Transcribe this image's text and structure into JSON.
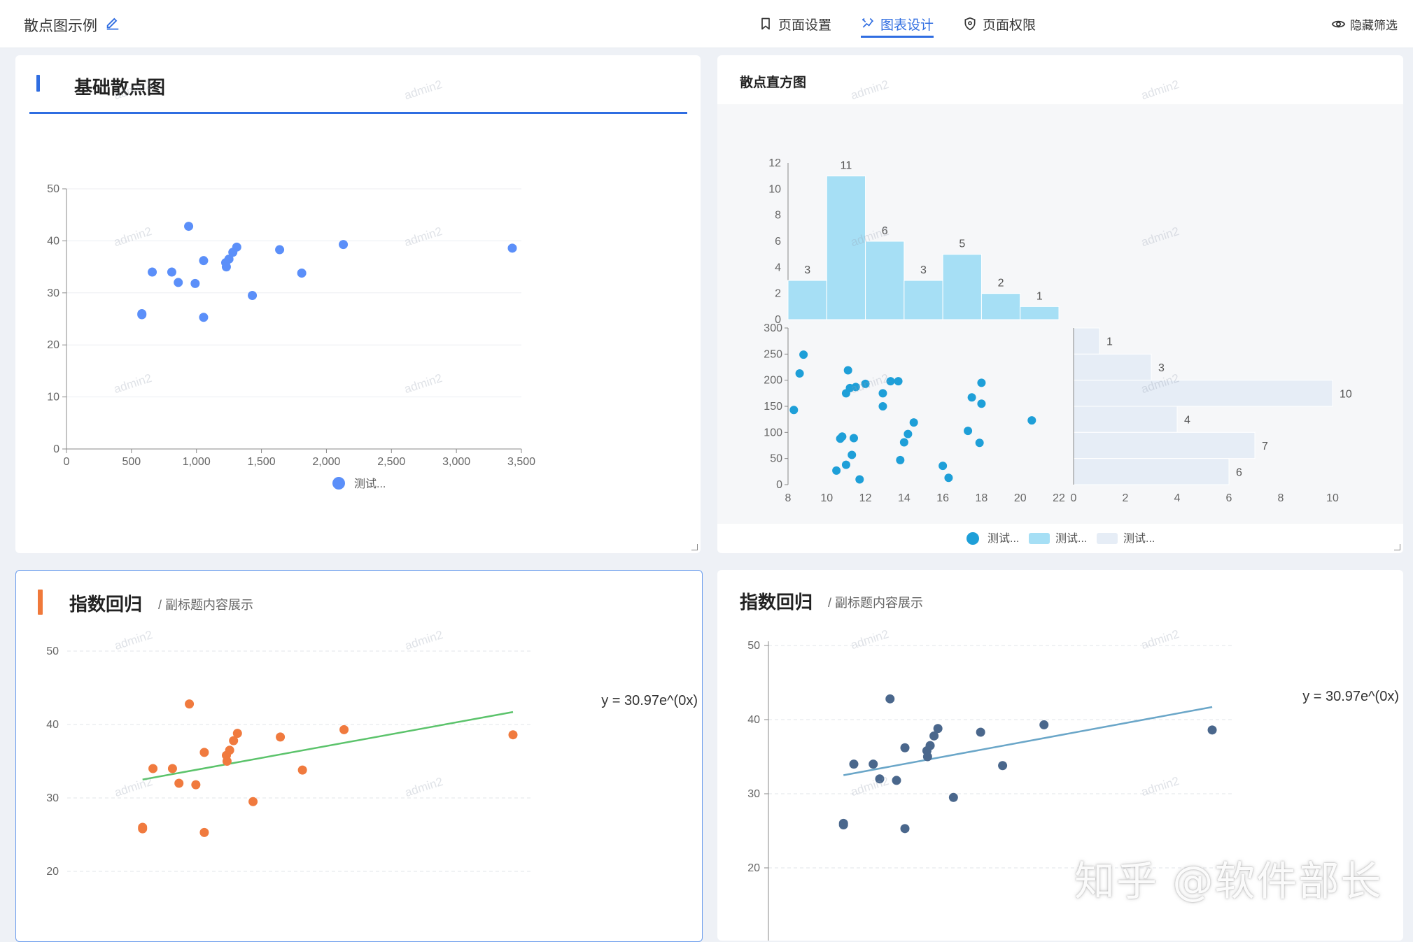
{
  "header": {
    "page_title": "散点图示例",
    "tabs": [
      {
        "label": "页面设置",
        "icon": "bookmark-icon",
        "active": false
      },
      {
        "label": "图表设计",
        "icon": "chart-design-icon",
        "active": true
      },
      {
        "label": "页面权限",
        "icon": "shield-icon",
        "active": false
      }
    ],
    "hide_filter_label": "隐藏筛选"
  },
  "watermark_text": "admin2",
  "corner_watermark": "知乎 @软件部长",
  "panels": {
    "p1": {
      "title": "基础散点图"
    },
    "p2": {
      "title": "散点直方图"
    },
    "p3": {
      "title": "指数回归",
      "subtitle": "/ 副标题内容展示"
    },
    "p4": {
      "title": "指数回归",
      "subtitle": "/ 副标题内容展示"
    }
  },
  "colors": {
    "accent": "#2f6de1",
    "p1_point": "#5b8ff9",
    "p2_point": "#1e9fd8",
    "p2_histx": "#a6dff5",
    "p2_histy": "#e6edf6",
    "p3_point": "#f07a3e",
    "p3_line": "#5bc36b",
    "p4_point": "#4a678c",
    "p4_line": "#6aa6c8"
  },
  "chart_data": [
    {
      "type": "scatter",
      "title": "基础散点图",
      "xlim": [
        0,
        3500
      ],
      "ylim": [
        0,
        50
      ],
      "x_ticks": [
        "0",
        "500",
        "1,000",
        "1,500",
        "2,000",
        "2,500",
        "3,000",
        "3,500"
      ],
      "y_ticks": [
        "0",
        "10",
        "20",
        "30",
        "40",
        "50"
      ],
      "legend": [
        "测试..."
      ],
      "points": [
        [
          580,
          26
        ],
        [
          580,
          25.8
        ],
        [
          660,
          34
        ],
        [
          810,
          34
        ],
        [
          860,
          32
        ],
        [
          940,
          42.8
        ],
        [
          990,
          31.8
        ],
        [
          1055,
          36.2
        ],
        [
          1055,
          25.3
        ],
        [
          1225,
          35.8
        ],
        [
          1230,
          35
        ],
        [
          1250,
          36.5
        ],
        [
          1280,
          37.8
        ],
        [
          1310,
          38.8
        ],
        [
          1430,
          29.5
        ],
        [
          1640,
          38.3
        ],
        [
          1810,
          33.8
        ],
        [
          2130,
          39.3
        ],
        [
          3430,
          38.6
        ]
      ]
    },
    {
      "type": "scatter",
      "title": "散点直方图",
      "xlim": [
        8,
        22
      ],
      "ylim": [
        0,
        300
      ],
      "x_ticks": [
        "8",
        "10",
        "12",
        "14",
        "16",
        "18",
        "20",
        "22"
      ],
      "y_ticks": [
        "0",
        "50",
        "100",
        "150",
        "200",
        "250",
        "300"
      ],
      "legend": [
        "测试...",
        "测试...",
        "测试..."
      ],
      "points": [
        [
          8.3,
          143
        ],
        [
          8.6,
          213
        ],
        [
          8.8,
          249
        ],
        [
          10.5,
          27
        ],
        [
          10.7,
          88
        ],
        [
          10.8,
          92
        ],
        [
          11,
          38
        ],
        [
          11,
          175
        ],
        [
          11.1,
          219
        ],
        [
          11.2,
          185
        ],
        [
          11.3,
          57
        ],
        [
          11.4,
          89
        ],
        [
          11.5,
          187
        ],
        [
          11.7,
          10
        ],
        [
          12,
          193
        ],
        [
          12.9,
          150
        ],
        [
          12.9,
          175
        ],
        [
          13.3,
          198
        ],
        [
          13.7,
          198
        ],
        [
          13.8,
          47
        ],
        [
          14,
          81
        ],
        [
          14.2,
          97
        ],
        [
          14.5,
          119
        ],
        [
          16,
          36
        ],
        [
          16.3,
          13
        ],
        [
          17.3,
          103
        ],
        [
          17.5,
          167
        ],
        [
          17.9,
          80
        ],
        [
          18,
          155
        ],
        [
          18,
          195
        ],
        [
          20.6,
          123
        ]
      ]
    },
    {
      "type": "bar",
      "title": "散点直方图 x-histogram",
      "categories": [
        "8-10",
        "10-12",
        "12-14",
        "14-16",
        "16-18",
        "18-20",
        "20-22"
      ],
      "values": [
        3,
        11,
        6,
        3,
        5,
        2,
        1
      ],
      "ylim": [
        0,
        12
      ],
      "y_ticks": [
        "0",
        "2",
        "4",
        "6",
        "8",
        "10",
        "12"
      ]
    },
    {
      "type": "bar",
      "title": "散点直方图 y-histogram",
      "categories": [
        "250-300",
        "200-250",
        "150-200",
        "100-150",
        "50-100",
        "0-50"
      ],
      "values": [
        1,
        3,
        10,
        4,
        7,
        6
      ],
      "xlim": [
        0,
        10
      ],
      "x_ticks": [
        "0",
        "2",
        "4",
        "6",
        "8",
        "10"
      ]
    },
    {
      "type": "scatter",
      "title": "指数回归",
      "xlim": [
        0,
        3500
      ],
      "ylim": [
        20,
        50
      ],
      "y_ticks": [
        "20",
        "30",
        "40",
        "50"
      ],
      "regression_label": "y = 30.97e^(0x)",
      "regression_line": [
        [
          580,
          32.5
        ],
        [
          3430,
          41.7
        ]
      ],
      "points": [
        [
          580,
          26
        ],
        [
          580,
          25.8
        ],
        [
          660,
          34
        ],
        [
          810,
          34
        ],
        [
          860,
          32
        ],
        [
          940,
          42.8
        ],
        [
          990,
          31.8
        ],
        [
          1055,
          36.2
        ],
        [
          1055,
          25.3
        ],
        [
          1225,
          35.8
        ],
        [
          1230,
          35
        ],
        [
          1250,
          36.5
        ],
        [
          1280,
          37.8
        ],
        [
          1310,
          38.8
        ],
        [
          1430,
          29.5
        ],
        [
          1640,
          38.3
        ],
        [
          1810,
          33.8
        ],
        [
          2130,
          39.3
        ],
        [
          3430,
          38.6
        ]
      ]
    },
    {
      "type": "scatter",
      "title": "指数回归",
      "xlim": [
        0,
        3500
      ],
      "ylim": [
        20,
        50
      ],
      "y_ticks": [
        "20",
        "30",
        "40",
        "50"
      ],
      "regression_label": "y = 30.97e^(0x)",
      "regression_line": [
        [
          580,
          32.5
        ],
        [
          3430,
          41.7
        ]
      ],
      "points": [
        [
          580,
          26
        ],
        [
          580,
          25.8
        ],
        [
          660,
          34
        ],
        [
          810,
          34
        ],
        [
          860,
          32
        ],
        [
          940,
          42.8
        ],
        [
          990,
          31.8
        ],
        [
          1055,
          36.2
        ],
        [
          1055,
          25.3
        ],
        [
          1225,
          35.8
        ],
        [
          1230,
          35
        ],
        [
          1250,
          36.5
        ],
        [
          1280,
          37.8
        ],
        [
          1310,
          38.8
        ],
        [
          1430,
          29.5
        ],
        [
          1640,
          38.3
        ],
        [
          1810,
          33.8
        ],
        [
          2130,
          39.3
        ],
        [
          3430,
          38.6
        ]
      ]
    }
  ]
}
